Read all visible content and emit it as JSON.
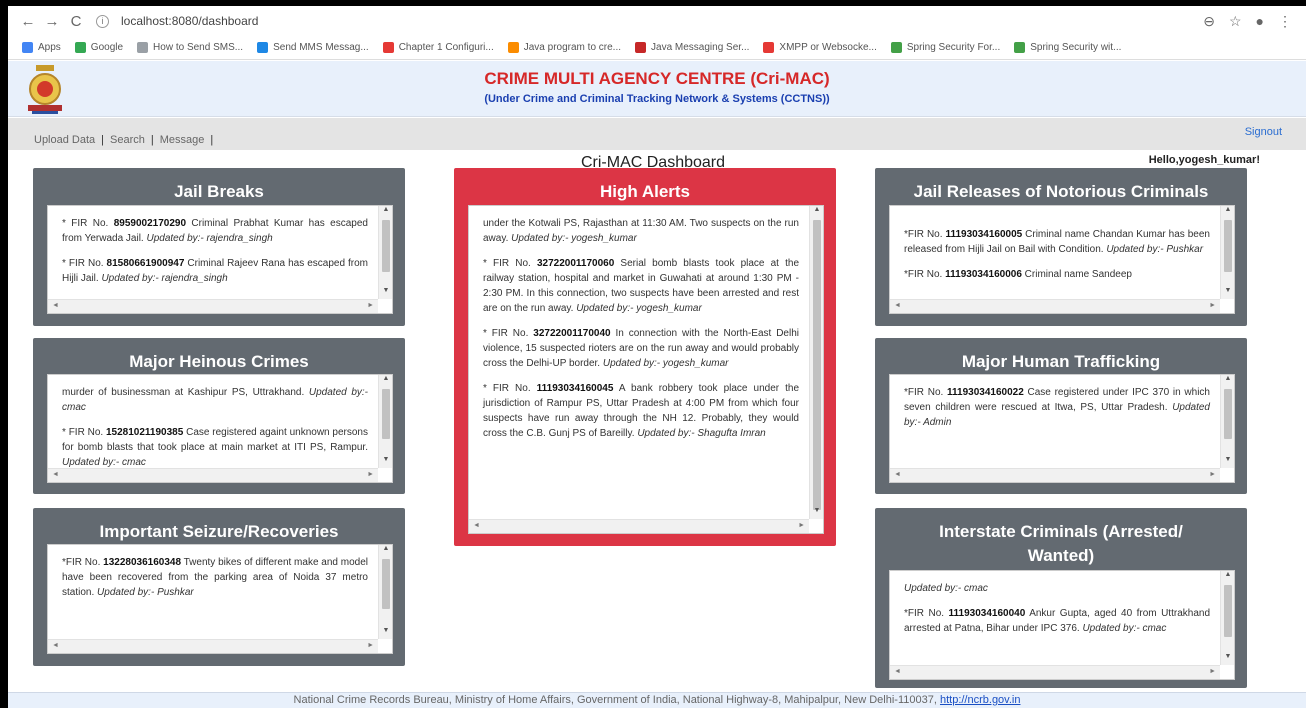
{
  "browser": {
    "url": "localhost:8080/dashboard",
    "bookmarks": [
      {
        "label": "Apps",
        "color": "#4285f4"
      },
      {
        "label": "Google",
        "color": "#34a853"
      },
      {
        "label": "How to Send SMS...",
        "color": "#9aa0a6"
      },
      {
        "label": "Send MMS Messag...",
        "color": "#1e88e5"
      },
      {
        "label": "Chapter 1 Configuri...",
        "color": "#e53935"
      },
      {
        "label": "Java program to cre...",
        "color": "#fb8c00"
      },
      {
        "label": "Java Messaging Ser...",
        "color": "#c62828"
      },
      {
        "label": "XMPP or Websocke...",
        "color": "#e53935"
      },
      {
        "label": "Spring Security For...",
        "color": "#43a047"
      },
      {
        "label": "Spring Security wit...",
        "color": "#43a047"
      }
    ]
  },
  "header": {
    "title": "CRIME MULTI AGENCY CENTRE (Cri-MAC)",
    "subtitle": "(Under Crime and Criminal Tracking Network & Systems (CCTNS))"
  },
  "menu": {
    "items": [
      "Upload Data",
      "Search",
      "Message"
    ],
    "signout": "Signout"
  },
  "dashboard": {
    "title": "Cri-MAC Dashboard",
    "greeting": "Hello,yogesh_kumar!"
  },
  "panels": {
    "jail_breaks": {
      "title": "Jail Breaks",
      "entries": [
        {
          "prefix": "* FIR No.",
          "fir": "8959002170290",
          "text": "Criminal Prabhat Kumar has escaped from Yerwada Jail.",
          "updated": "Updated by:- rajendra_singh"
        },
        {
          "prefix": "* FIR No.",
          "fir": "81580661900947",
          "text": "Criminal Rajeev Rana has escaped from Hijli Jail.",
          "updated": "Updated by:- rajendra_singh"
        }
      ]
    },
    "heinous": {
      "title": "Major Heinous Crimes",
      "lead": "murder of businessman at Kashipur PS, Uttrakhand.",
      "lead_updated": "Updated by:- cmac",
      "entries": [
        {
          "prefix": "* FIR No.",
          "fir": "15281021190385",
          "text": "Case registered againt unknown persons for bomb blasts that took place at main market at ITI PS, Rampur.",
          "updated": "Updated by:- cmac"
        }
      ]
    },
    "seizure": {
      "title": "Important Seizure/Recoveries",
      "entries": [
        {
          "prefix": "*FIR No.",
          "fir": "13228036160348",
          "text": "Twenty bikes of different make and model have been recovered from the parking area of Noida 37 metro station.",
          "updated": "Updated by:- Pushkar"
        }
      ]
    },
    "alerts": {
      "title": "High Alerts",
      "lead": "under the Kotwali PS, Rajasthan at 11:30 AM. Two suspects on the run away.",
      "lead_updated": "Updated by:- yogesh_kumar",
      "entries": [
        {
          "prefix": "* FIR No.",
          "fir": "32722001170060",
          "text": "Serial bomb blasts took place at the railway station, hospital and market in Guwahati at around 1:30 PM - 2:30 PM. In this connection, two suspects have been arrested and rest are on the run away.",
          "updated": "Updated by:- yogesh_kumar"
        },
        {
          "prefix": "* FIR No.",
          "fir": "32722001170040",
          "text": "In connection with the North-East Delhi violence, 15 suspected rioters are on the run away and would probably cross the Delhi-UP border.",
          "updated": "Updated by:- yogesh_kumar"
        },
        {
          "prefix": "* FIR No.",
          "fir": "11193034160045",
          "text": "A bank robbery took place under the jurisdiction of Rampur PS, Uttar Pradesh at 4:00 PM from which four suspects have run away through the NH 12. Probably, they would cross the C.B. Gunj PS of Bareilly.",
          "updated": "Updated by:- Shagufta Imran"
        }
      ]
    },
    "releases": {
      "title": "Jail Releases of Notorious Criminals",
      "entries": [
        {
          "prefix": "*FIR No.",
          "fir": "11193034160005",
          "text": "Criminal name Chandan Kumar has been released from Hijli Jail on Bail with Condition.",
          "updated": "Updated by:- Pushkar"
        },
        {
          "prefix": "*FIR No.",
          "fir": "11193034160006",
          "text": "Criminal name Sandeep",
          "updated": ""
        }
      ]
    },
    "trafficking": {
      "title": "Major Human Trafficking",
      "entries": [
        {
          "prefix": "*FIR No.",
          "fir": "11193034160022",
          "text": "Case registered under IPC 370 in which seven children were rescued at Itwa, PS, Uttar Pradesh.",
          "updated": "Updated by:- Admin"
        }
      ]
    },
    "interstate": {
      "title": "Interstate Criminals (Arrested/ Wanted)",
      "lead_updated": "Updated by:- cmac",
      "entries": [
        {
          "prefix": "*FIR No.",
          "fir": "11193034160040",
          "text": "Ankur Gupta, aged 40 from Uttrakhand arrested at Patna, Bihar under IPC 376.",
          "updated": "Updated by:- cmac"
        }
      ]
    }
  },
  "footer": {
    "text": "National Crime Records Bureau, Ministry of Home Affairs, Government of India, National Highway-8, Mahipalpur, New Delhi-110037,",
    "link": "http://ncrb.gov.in"
  },
  "colors": {
    "panel": "#636a71",
    "alert": "#dc3545",
    "title_red": "#d62828",
    "subtitle_blue": "#1a3fb0"
  }
}
